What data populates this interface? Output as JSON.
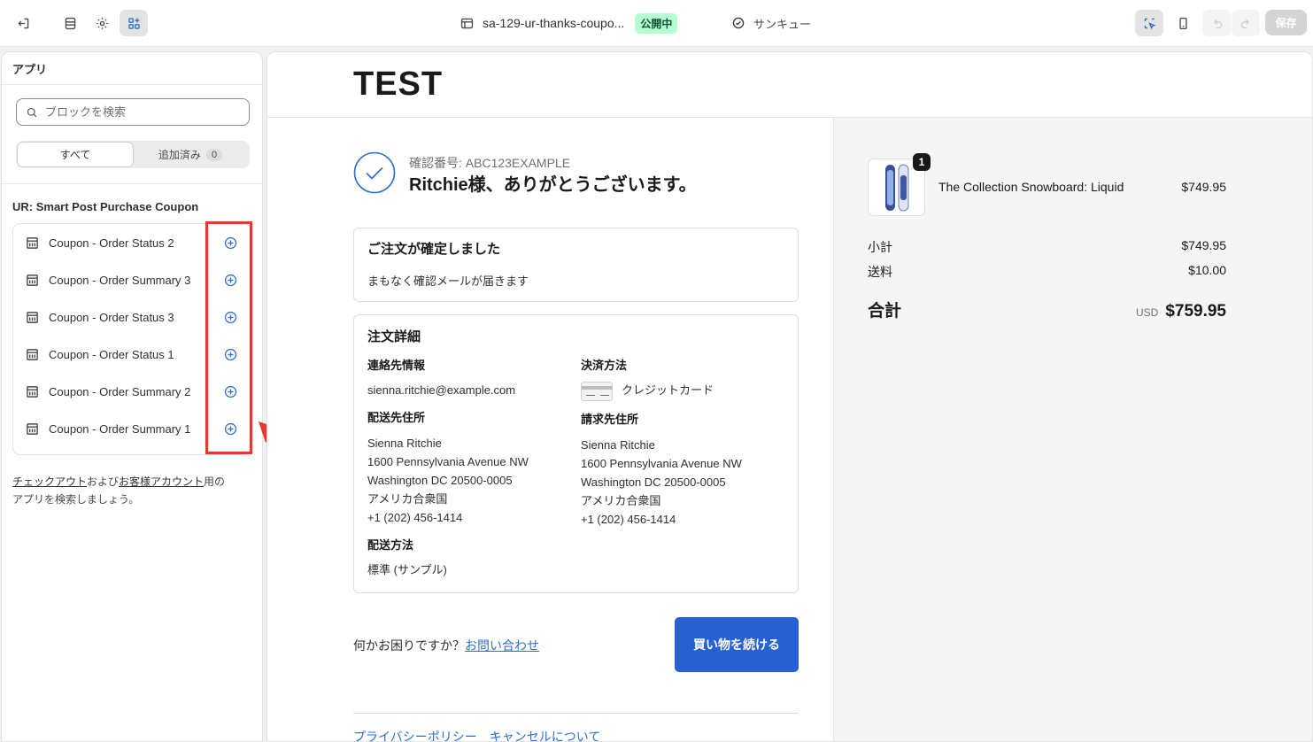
{
  "topbar": {
    "theme_name": "sa-129-ur-thanks-coupo...",
    "status_badge": "公開中",
    "page_name": "サンキュー",
    "save_label": "保存"
  },
  "sidebar": {
    "title": "アプリ",
    "search_placeholder": "ブロックを検索",
    "tabs": {
      "all": "すべて",
      "added": "追加済み",
      "added_count": "0"
    },
    "group_title": "UR: Smart Post Purchase Coupon",
    "items": [
      {
        "label": "Coupon - Order Status 2"
      },
      {
        "label": "Coupon - Order Summary 3"
      },
      {
        "label": "Coupon - Order Status 3"
      },
      {
        "label": "Coupon - Order Status 1"
      },
      {
        "label": "Coupon - Order Summary 2"
      },
      {
        "label": "Coupon - Order Summary 1"
      }
    ],
    "help": {
      "link1": "チェックアウト",
      "mid": "および",
      "link2": "お客様アカウント",
      "end": "用の",
      "line2": "アプリを検索しましょう。"
    }
  },
  "preview": {
    "logo": "TEST",
    "confirmation": "確認番号: ABC123EXAMPLE",
    "thanks": "Ritchie様、ありがとうございます。",
    "confirmed_card": {
      "heading": "ご注文が確定しました",
      "text": "まもなく確認メールが届きます"
    },
    "details": {
      "heading": "注文詳細",
      "contact_label": "連絡先情報",
      "contact_email": "sienna.ritchie@example.com",
      "shipping_addr_label": "配送先住所",
      "shipping_addr": [
        "Sienna Ritchie",
        "1600 Pennsylvania Avenue NW",
        "Washington DC 20500-0005",
        "アメリカ合衆国",
        "+1 (202) 456-1414"
      ],
      "shipping_method_label": "配送方法",
      "shipping_method": "標準 (サンプル)",
      "payment_label": "決済方法",
      "payment_value": "クレジットカード",
      "billing_label": "請求先住所",
      "billing_addr": [
        "Sienna Ritchie",
        "1600 Pennsylvania Avenue NW",
        "Washington DC 20500-0005",
        "アメリカ合衆国",
        "+1 (202) 456-1414"
      ]
    },
    "help_text": "何かお困りですか？",
    "help_link": "お問い合わせ",
    "continue_button": "買い物を続ける",
    "footer_links": [
      "プライバシーポリシー",
      "キャンセルについて"
    ],
    "summary": {
      "qty": "1",
      "product": "The Collection Snowboard: Liquid",
      "product_price": "$749.95",
      "subtotal_label": "小計",
      "subtotal": "$749.95",
      "shipping_label": "送料",
      "shipping": "$10.00",
      "total_label": "合計",
      "currency": "USD",
      "total": "$759.95"
    }
  },
  "colors": {
    "accent": "#2c6ecb",
    "button": "#2760d1",
    "highlight": "#e53a2b",
    "badge_bg": "#b4fed2"
  }
}
